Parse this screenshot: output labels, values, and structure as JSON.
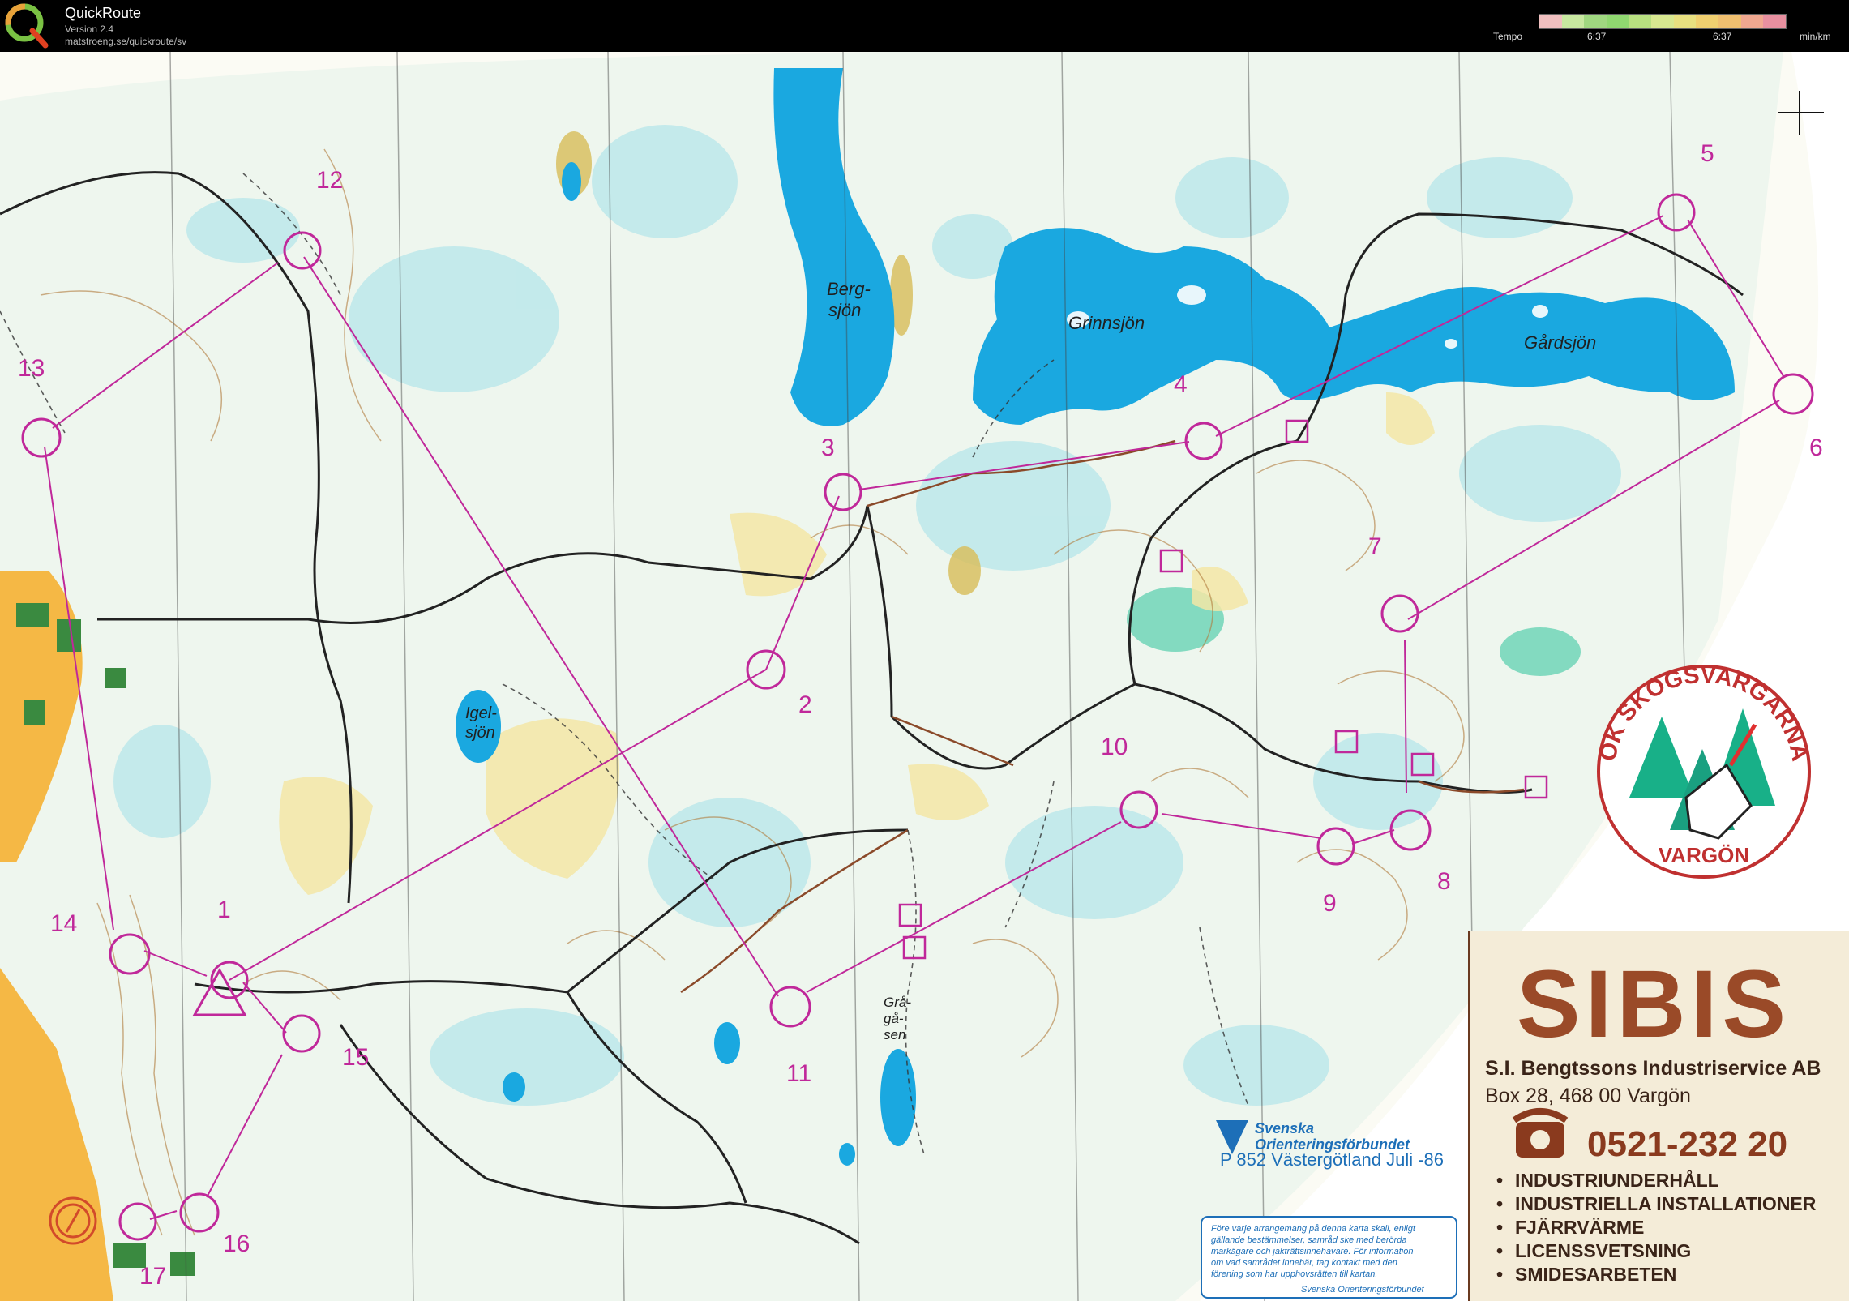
{
  "app": {
    "title": "QuickRoute",
    "version": "Version 2.4",
    "url": "matstroeng.se/quickroute/sv"
  },
  "tempo": {
    "label": "Tempo",
    "tick_left": "6:37",
    "tick_right": "6:37",
    "unit": "min/km",
    "colors": [
      "#f0c0c0",
      "#c8e8a0",
      "#a0d880",
      "#90d870",
      "#b8e080",
      "#d8e890",
      "#e8e080",
      "#f0d070",
      "#f0c070",
      "#f0a890",
      "#e890a0"
    ]
  },
  "map": {
    "lakes": {
      "bergsjon": "Berg-\nsjön",
      "grinnsjon": "Grinnsjön",
      "gardsjon": "Gårdsjön",
      "igelsjon_1": "Igel-",
      "igelsjon_2": "sjön",
      "gragasen_1": "Grå-",
      "gragasen_2": "gå-",
      "gragasen_3": "sen"
    },
    "controls": [
      "1",
      "2",
      "3",
      "4",
      "5",
      "6",
      "7",
      "8",
      "9",
      "10",
      "11",
      "12",
      "13",
      "14",
      "15",
      "16",
      "17"
    ],
    "club_logo": {
      "top": "OK SKOGSVARGARNA",
      "bottom": "VARGÖN"
    },
    "sponsor": {
      "name": "SIBIS",
      "company": "S.I. Bengtssons Industriservice AB",
      "address": "Box 28, 468 00 Vargön",
      "phone": "0521-232 20",
      "services": [
        "INDUSTRIUNDERHÅLL",
        "INDUSTRIELLA INSTALLATIONER",
        "FJÄRRVÄRME",
        "LICENSSVETSNING",
        "SMIDESARBETEN"
      ]
    },
    "federation": {
      "line1": "Svenska",
      "line2": "Orienteringsförbundet",
      "map_info": "P 852 Västergötland Juli -86"
    },
    "notice": {
      "lines": [
        "Före varje arrangemang på denna karta skall, enligt",
        "gällande bestämmelser, samråd ske med berörda",
        "markägare och jakträttsinnehavare. För information",
        "om vad samrådet innebär, tag kontakt med den",
        "förening som har upphovsrätten till kartan."
      ],
      "signature": "Svenska Orienteringsförbundet"
    }
  }
}
